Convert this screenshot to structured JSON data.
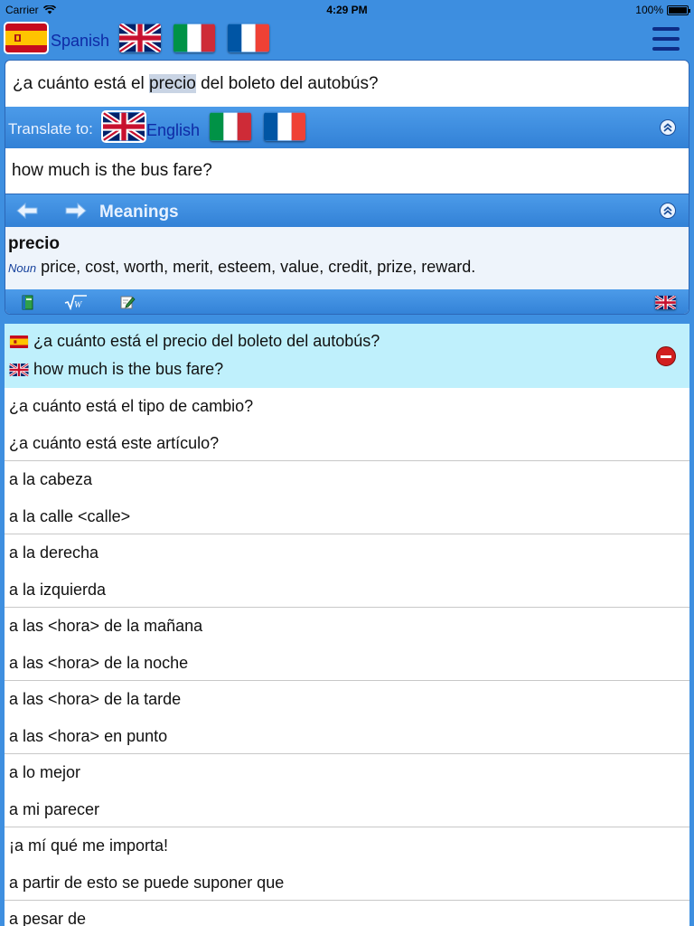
{
  "status_bar": {
    "carrier": "Carrier",
    "time": "4:29 PM",
    "battery": "100%"
  },
  "source_language": {
    "label": "Spanish",
    "flag": "spain-flag"
  },
  "top_flags": [
    "uk-flag",
    "italy-flag",
    "france-flag"
  ],
  "input": {
    "before": "¿a cuánto está el ",
    "highlight": "precio",
    "after": " del boleto del autobús?"
  },
  "translate": {
    "label": "Translate to:",
    "target_label": "English",
    "target_flag": "uk-flag",
    "other_flags": [
      "italy-flag",
      "france-flag"
    ]
  },
  "output_text": "how much is the bus fare?",
  "meanings": {
    "title": "Meanings",
    "word": "precio",
    "part_of_speech": "Noun",
    "definitions": "price, cost, worth, merit, esteem, value, credit, prize, reward."
  },
  "toolbar": {
    "icons": [
      "book-icon",
      "root-icon",
      "edit-icon",
      "uk-flag"
    ]
  },
  "history": {
    "current": {
      "source": "¿a cuánto está el precio del boleto del autobús?",
      "translation": "how much is the bus fare?"
    },
    "phrases": [
      "¿a cuánto está el tipo de cambio?",
      "¿a cuánto está este artículo?",
      "a la cabeza",
      "a la calle <calle>",
      "a la derecha",
      "a la izquierda",
      "a las <hora> de la mañana",
      "a las <hora> de la noche",
      "a las <hora> de la tarde",
      "a las <hora> en punto",
      "a lo mejor",
      "a mi parecer",
      "¡a mí qué me importa!",
      "a partir de esto se puede suponer que",
      "a pesar de"
    ]
  },
  "colors": {
    "accent": "#3e8fe0",
    "highlight_row": "#bff0fc",
    "language_label": "#0e2aa6"
  }
}
